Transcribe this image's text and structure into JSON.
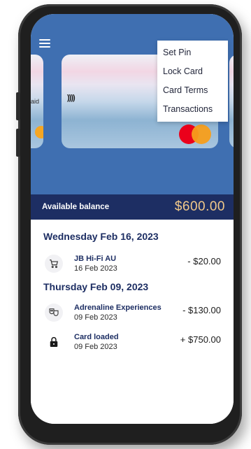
{
  "menu": {
    "items": [
      "Set Pin",
      "Lock Card",
      "Card Terms",
      "Transactions"
    ]
  },
  "card": {
    "left_fragment_text": "aid",
    "contactless_symbol": "))))",
    "brand": "mastercard"
  },
  "balance": {
    "label": "Available balance",
    "amount": "$600.00"
  },
  "groups": [
    {
      "date": "Wednesday Feb 16, 2023",
      "transactions": [
        {
          "icon": "cart-icon",
          "name": "JB Hi-Fi AU",
          "date": "16 Feb 2023",
          "amount": "- $20.00"
        }
      ]
    },
    {
      "date": "Thursday Feb 09, 2023",
      "transactions": [
        {
          "icon": "theater-masks-icon",
          "name": "Adrenaline Experiences",
          "date": "09 Feb 2023",
          "amount": "- $130.00"
        },
        {
          "icon": "lock-icon",
          "name": "Card loaded",
          "date": "09 Feb 2023",
          "amount": "+ $750.00"
        }
      ]
    }
  ],
  "colors": {
    "header_blue": "#3f6fb1",
    "navy": "#1d2e63",
    "balance_gold": "#f2c98a"
  }
}
